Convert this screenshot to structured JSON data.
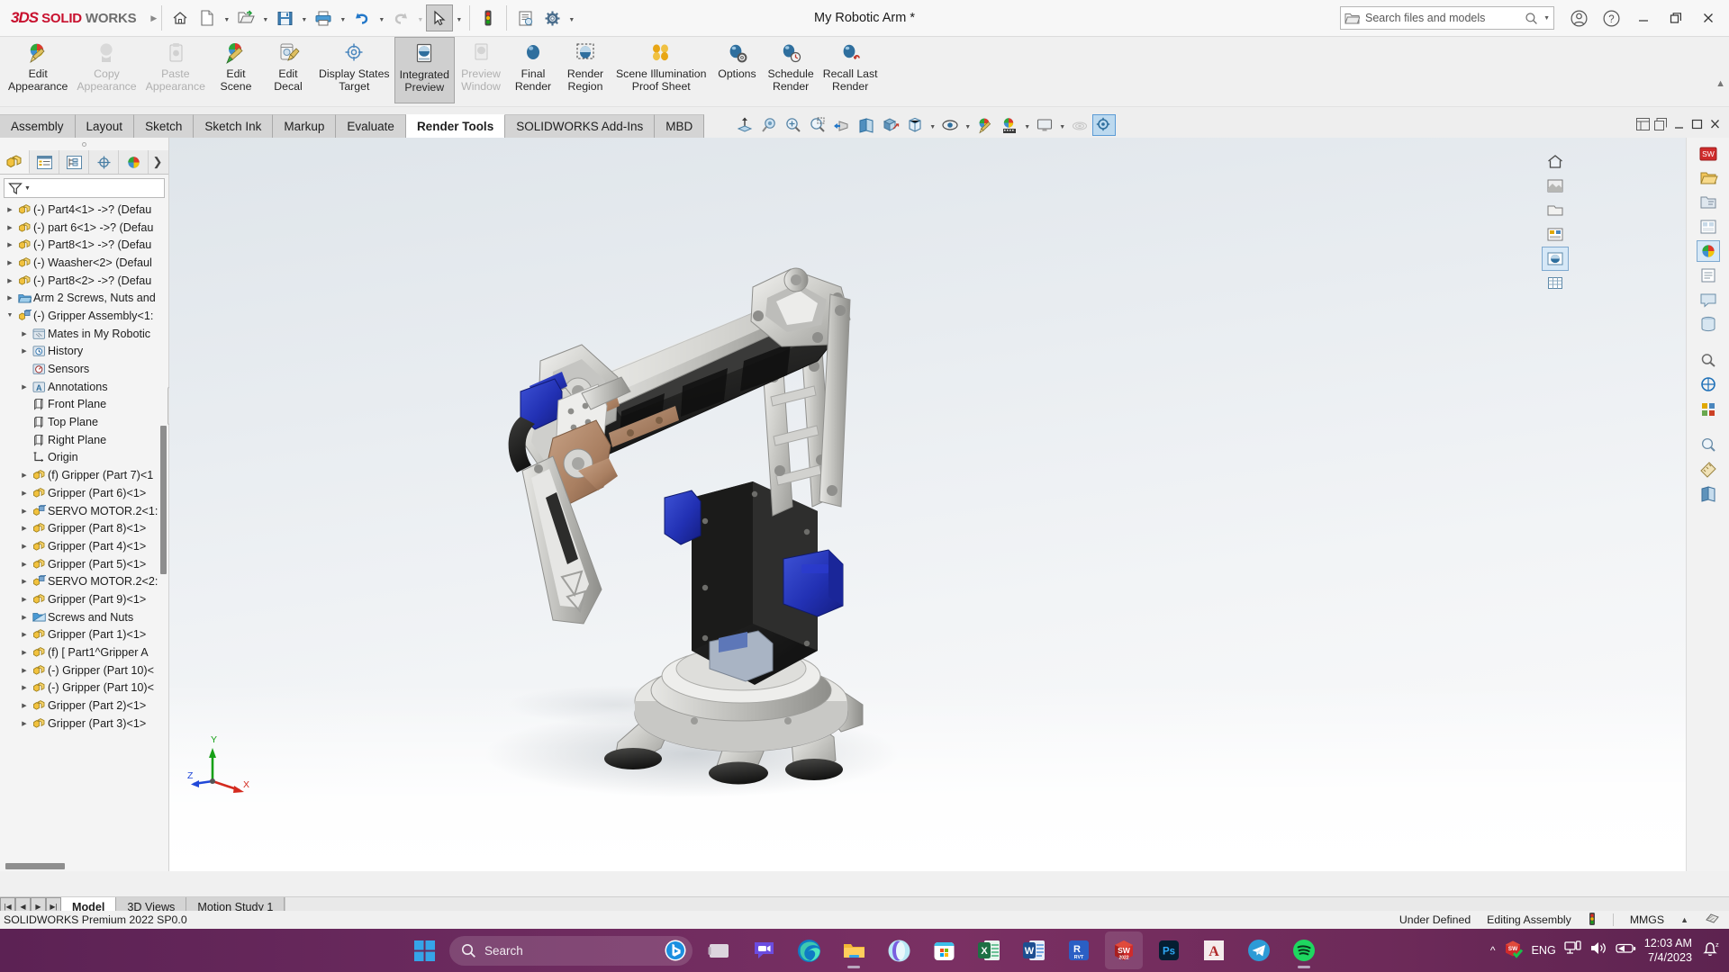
{
  "titlebar": {
    "logo_ds": "3DS",
    "logo_solid": "SOLID",
    "logo_works": "WORKS",
    "document_title": "My Robotic Arm *",
    "quick_access": [
      {
        "name": "home",
        "icon": "home-icon"
      },
      {
        "name": "new",
        "icon": "new-document-icon",
        "caret": true
      },
      {
        "name": "open",
        "icon": "open-folder-icon",
        "caret": true
      },
      {
        "name": "save",
        "icon": "save-disk-icon",
        "caret": true
      },
      {
        "name": "print",
        "icon": "printer-icon",
        "caret": true
      },
      {
        "name": "undo",
        "icon": "undo-arrow-icon",
        "caret": true
      },
      {
        "name": "redo",
        "icon": "redo-arrow-icon",
        "caret": true,
        "disabled": true
      },
      {
        "name": "select",
        "icon": "cursor-arrow-icon",
        "caret": true,
        "selected": true
      },
      {
        "name": "rebuild",
        "icon": "traffic-light-icon"
      },
      {
        "name": "file-properties",
        "icon": "file-properties-icon"
      },
      {
        "name": "options",
        "icon": "gear-icon",
        "caret": true
      }
    ],
    "search": {
      "placeholder": "Search files and models",
      "value": ""
    },
    "right_buttons": [
      {
        "name": "account",
        "icon": "user-circle-icon"
      },
      {
        "name": "help",
        "icon": "question-circle-icon"
      },
      {
        "name": "minimize",
        "icon": "minimize-icon"
      },
      {
        "name": "restore",
        "icon": "restore-icon"
      },
      {
        "name": "close",
        "icon": "close-icon"
      }
    ]
  },
  "ribbon": {
    "items": [
      {
        "label1": "Edit",
        "label2": "Appearance",
        "icon": "appearance-pencil-icon",
        "disabled": false
      },
      {
        "label1": "Copy",
        "label2": "Appearance",
        "icon": "copy-appearance-icon",
        "disabled": true
      },
      {
        "label1": "Paste",
        "label2": "Appearance",
        "icon": "paste-appearance-icon",
        "disabled": true
      },
      {
        "label1": "Edit",
        "label2": "Scene",
        "icon": "edit-scene-icon",
        "disabled": false
      },
      {
        "label1": "Edit",
        "label2": "Decal",
        "icon": "edit-decal-icon",
        "disabled": false
      },
      {
        "label1": "Display States",
        "label2": "Target",
        "icon": "display-states-target-icon",
        "disabled": false
      },
      {
        "label1": "Integrated",
        "label2": "Preview",
        "icon": "integrated-preview-icon",
        "active": true
      },
      {
        "label1": "Preview",
        "label2": "Window",
        "icon": "preview-window-icon",
        "disabled": true
      },
      {
        "label1": "Final",
        "label2": "Render",
        "icon": "final-render-icon",
        "disabled": false
      },
      {
        "label1": "Render",
        "label2": "Region",
        "icon": "render-region-icon",
        "disabled": false
      },
      {
        "label1": "Scene Illumination",
        "label2": "Proof Sheet",
        "icon": "scene-illumination-proof-sheet-icon",
        "disabled": false
      },
      {
        "label1": "Options",
        "label2": "",
        "icon": "render-options-icon",
        "disabled": false
      },
      {
        "label1": "Schedule",
        "label2": "Render",
        "icon": "schedule-render-icon",
        "disabled": false
      },
      {
        "label1": "Recall Last",
        "label2": "Render",
        "icon": "recall-last-render-icon",
        "disabled": false
      }
    ]
  },
  "command_tabs": {
    "tabs": [
      {
        "label": "Assembly",
        "active": false
      },
      {
        "label": "Layout",
        "active": false
      },
      {
        "label": "Sketch",
        "active": false
      },
      {
        "label": "Sketch Ink",
        "active": false
      },
      {
        "label": "Markup",
        "active": false
      },
      {
        "label": "Evaluate",
        "active": false
      },
      {
        "label": "Render Tools",
        "active": true
      },
      {
        "label": "SOLIDWORKS Add-Ins",
        "active": false
      },
      {
        "label": "MBD",
        "active": false
      }
    ],
    "heads_up": [
      {
        "name": "zoom-to-fit-icon",
        "caret": false
      },
      {
        "name": "zoom-to-area-icon",
        "caret": false
      },
      {
        "name": "zoom-in-out-icon",
        "caret": false
      },
      {
        "name": "previous-view-icon",
        "caret": false
      },
      {
        "name": "section-view-icon",
        "caret": false
      },
      {
        "name": "view-orientation-icon",
        "caret": false
      },
      {
        "name": "display-style-icon",
        "caret": true
      },
      {
        "name": "hide-show-items-icon",
        "caret": true
      },
      {
        "name": "edit-appearance-icon",
        "caret": false
      },
      {
        "name": "apply-scene-icon",
        "caret": true
      },
      {
        "name": "view-settings-icon",
        "caret": true
      },
      {
        "name": "shadows-icon",
        "caret": false
      },
      {
        "name": "perspective-icon",
        "caret": false,
        "selected": true
      }
    ],
    "document_controls": [
      {
        "name": "tile-windows-icon"
      },
      {
        "name": "restore-document-icon"
      },
      {
        "name": "minimize-document-icon"
      },
      {
        "name": "maximize-document-icon"
      },
      {
        "name": "close-document-icon"
      }
    ]
  },
  "feature_tree": {
    "tabs": [
      {
        "name": "feature-manager-design-tree-tab",
        "icon": "yellow-part-icon",
        "active": true
      },
      {
        "name": "property-manager-tab",
        "icon": "property-list-icon",
        "active": false
      },
      {
        "name": "configuration-manager-tab",
        "icon": "configuration-icon",
        "active": false
      },
      {
        "name": "dimxpert-manager-tab",
        "icon": "dimxpert-target-icon",
        "active": false
      },
      {
        "name": "display-manager-tab",
        "icon": "display-manager-sphere-icon",
        "active": false
      }
    ],
    "filter_placeholder": "",
    "nodes": [
      {
        "indent": 0,
        "arrow": true,
        "icon": "part-icon",
        "label": "(-) Part4<1> ->? (Defau"
      },
      {
        "indent": 0,
        "arrow": true,
        "icon": "part-icon",
        "label": "(-) part 6<1> ->? (Defau"
      },
      {
        "indent": 0,
        "arrow": true,
        "icon": "part-icon",
        "label": "(-) Part8<1> ->? (Defau"
      },
      {
        "indent": 0,
        "arrow": true,
        "icon": "part-icon",
        "label": "(-) Waasher<2>  (Defaul"
      },
      {
        "indent": 0,
        "arrow": true,
        "icon": "part-icon",
        "label": "(-) Part8<2> ->? (Defau"
      },
      {
        "indent": 0,
        "arrow": true,
        "icon": "folder-icon",
        "label": "Arm 2 Screws, Nuts and"
      },
      {
        "indent": 0,
        "arrow": "down",
        "icon": "subassembly-icon",
        "label": "(-) Gripper Assembly<1:"
      },
      {
        "indent": 1,
        "arrow": true,
        "icon": "mates-icon",
        "label": "Mates in My Robotic"
      },
      {
        "indent": 1,
        "arrow": true,
        "icon": "history-icon",
        "label": "History"
      },
      {
        "indent": 1,
        "arrow": false,
        "icon": "sensors-icon",
        "label": "Sensors"
      },
      {
        "indent": 1,
        "arrow": true,
        "icon": "annotations-icon",
        "label": "Annotations"
      },
      {
        "indent": 1,
        "arrow": false,
        "icon": "plane-icon",
        "label": "Front Plane"
      },
      {
        "indent": 1,
        "arrow": false,
        "icon": "plane-icon",
        "label": "Top Plane"
      },
      {
        "indent": 1,
        "arrow": false,
        "icon": "plane-icon",
        "label": "Right Plane"
      },
      {
        "indent": 1,
        "arrow": false,
        "icon": "origin-icon",
        "label": "Origin"
      },
      {
        "indent": 1,
        "arrow": true,
        "icon": "part-icon",
        "label": "(f) Gripper (Part 7)<1"
      },
      {
        "indent": 1,
        "arrow": true,
        "icon": "part-icon",
        "label": "Gripper (Part 6)<1>"
      },
      {
        "indent": 1,
        "arrow": true,
        "icon": "subassembly-icon",
        "label": "SERVO MOTOR.2<1:"
      },
      {
        "indent": 1,
        "arrow": true,
        "icon": "part-icon",
        "label": "Gripper (Part 8)<1>"
      },
      {
        "indent": 1,
        "arrow": true,
        "icon": "part-icon",
        "label": "Gripper (Part 4)<1>"
      },
      {
        "indent": 1,
        "arrow": true,
        "icon": "part-icon",
        "label": "Gripper (Part 5)<1>"
      },
      {
        "indent": 1,
        "arrow": true,
        "icon": "subassembly-icon",
        "label": "SERVO MOTOR.2<2:"
      },
      {
        "indent": 1,
        "arrow": true,
        "icon": "part-icon",
        "label": "Gripper (Part 9)<1>"
      },
      {
        "indent": 1,
        "arrow": true,
        "icon": "folder-blue-icon",
        "label": "Screws and Nuts"
      },
      {
        "indent": 1,
        "arrow": true,
        "icon": "part-icon",
        "label": "Gripper (Part 1)<1>"
      },
      {
        "indent": 1,
        "arrow": true,
        "icon": "part-icon",
        "label": "(f) [ Part1^Gripper A"
      },
      {
        "indent": 1,
        "arrow": true,
        "icon": "part-icon",
        "label": "(-) Gripper (Part 10)<"
      },
      {
        "indent": 1,
        "arrow": true,
        "icon": "part-icon",
        "label": "(-) Gripper (Part 10)<"
      },
      {
        "indent": 1,
        "arrow": true,
        "icon": "part-icon",
        "label": "Gripper (Part 2)<1>"
      },
      {
        "indent": 1,
        "arrow": true,
        "icon": "part-icon",
        "label": "Gripper (Part 3)<1>"
      }
    ]
  },
  "graphics": {
    "triad_axes": [
      {
        "label": "X",
        "color": "#d42a1e"
      },
      {
        "label": "Y",
        "color": "#17a017"
      },
      {
        "label": "Z",
        "color": "#2148d8"
      }
    ],
    "model_name": "robotic-arm-3d-model"
  },
  "right_rail": {
    "view_buttons": [
      {
        "name": "view-home-icon"
      },
      {
        "name": "view-scene-icon"
      },
      {
        "name": "view-display-icon"
      },
      {
        "name": "view-appearances-icon"
      },
      {
        "name": "view-render-icon",
        "selected": true
      },
      {
        "name": "view-tables-icon"
      }
    ],
    "task_pane": [
      {
        "name": "solidworks-resources-icon"
      },
      {
        "name": "design-library-icon"
      },
      {
        "name": "file-explorer-icon"
      },
      {
        "name": "view-palette-icon"
      },
      {
        "name": "appearances-scenes-decals-icon",
        "selected": true
      },
      {
        "name": "custom-properties-icon"
      },
      {
        "name": "solidworks-forum-icon"
      },
      {
        "name": "pdm-icon"
      },
      {
        "name": "search-tasks-icon"
      },
      {
        "name": "3dexperience-icon"
      },
      {
        "name": "addins-icon"
      }
    ]
  },
  "bottom_tabs": {
    "nav": [
      {
        "name": "first-tab-button",
        "glyph": "|◀"
      },
      {
        "name": "previous-tab-button",
        "glyph": "◀"
      },
      {
        "name": "next-tab-button",
        "glyph": "▶"
      },
      {
        "name": "last-tab-button",
        "glyph": "▶|"
      }
    ],
    "tabs": [
      {
        "label": "Model",
        "active": true
      },
      {
        "label": "3D Views",
        "active": false
      },
      {
        "label": "Motion Study 1",
        "active": false
      }
    ]
  },
  "status_bar": {
    "left": "SOLIDWORKS Premium 2022 SP0.0",
    "state": "Under Defined",
    "mode": "Editing Assembly",
    "rebuild_icon": "traffic-light-icon",
    "units": "MMGS",
    "units_caret": "▲",
    "overlay_icon": "overlay-icon"
  },
  "taskbar": {
    "start": "windows-start-icon",
    "search_placeholder": "Search",
    "search_icon": "search-icon",
    "copilot_icon": "bing-copilot-icon",
    "apps": [
      {
        "name": "task-view-icon",
        "running": false
      },
      {
        "name": "chat-teams-icon",
        "running": false
      },
      {
        "name": "microsoft-edge-icon",
        "running": false
      },
      {
        "name": "file-explorer-icon",
        "running": true
      },
      {
        "name": "opera-browser-icon",
        "running": false
      },
      {
        "name": "microsoft-store-icon",
        "running": false
      },
      {
        "name": "microsoft-excel-icon",
        "running": false
      },
      {
        "name": "microsoft-word-icon",
        "running": false
      },
      {
        "name": "autodesk-revit-icon",
        "running": false
      },
      {
        "name": "solidworks-2022-icon",
        "running": true,
        "active": true,
        "badge": "2022"
      },
      {
        "name": "adobe-photoshop-icon",
        "running": false
      },
      {
        "name": "autodesk-autocad-icon",
        "running": false
      },
      {
        "name": "telegram-icon",
        "running": false
      },
      {
        "name": "spotify-icon",
        "running": true
      }
    ],
    "tray": {
      "chevron": "^",
      "sw_tray_icon": "solidworks-tray-icon",
      "language": "ENG",
      "network_icon": "network-icon",
      "volume_icon": "volume-icon",
      "battery_icon": "battery-icon",
      "time": "12:03 AM",
      "date": "7/4/2023",
      "notification_icon": "notification-bell-icon"
    }
  }
}
